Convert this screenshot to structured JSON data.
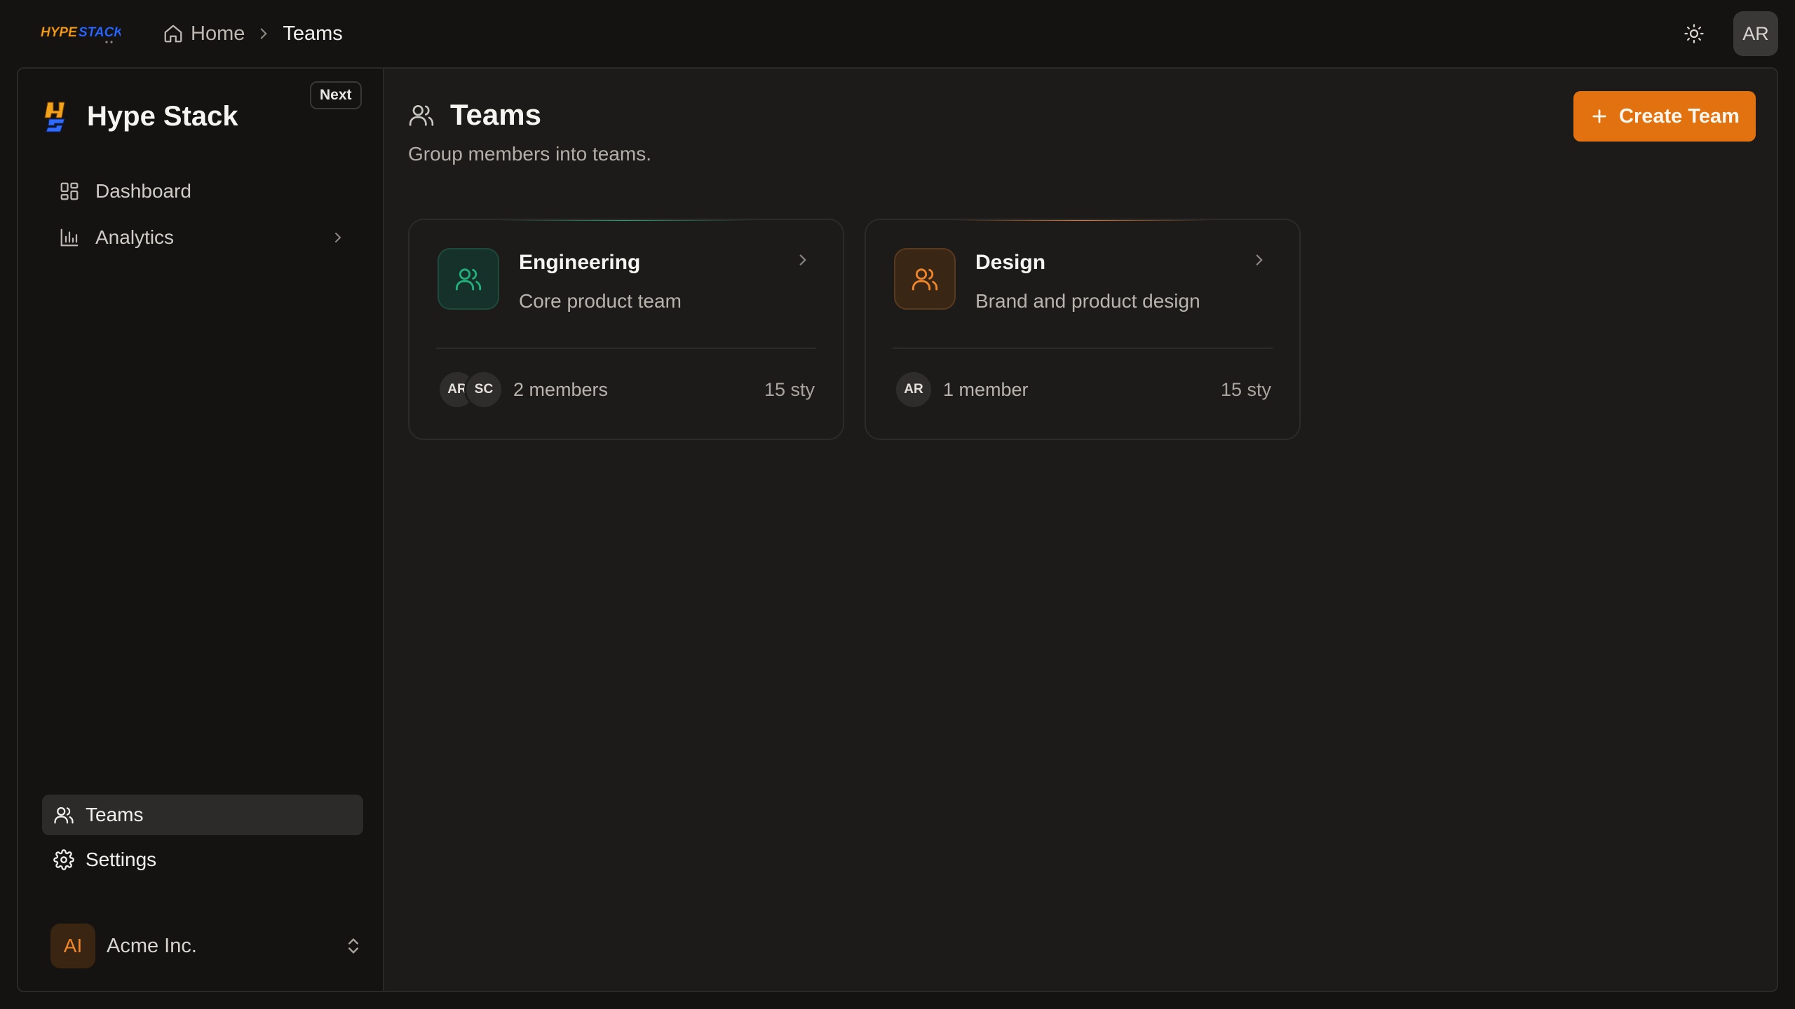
{
  "topbar": {
    "logo_text": "HYPE STACK",
    "breadcrumb": {
      "home": "Home",
      "current": "Teams"
    },
    "user_initials": "AR"
  },
  "sidebar": {
    "brand_name": "Hype Stack",
    "badge": "Next",
    "nav": [
      {
        "label": "Dashboard",
        "icon": "dashboard-icon"
      },
      {
        "label": "Analytics",
        "icon": "bar-chart-icon"
      }
    ],
    "bottom_nav": [
      {
        "label": "Teams",
        "icon": "users-icon",
        "active": true
      },
      {
        "label": "Settings",
        "icon": "gear-icon"
      }
    ],
    "org": {
      "initials": "AI",
      "name": "Acme Inc."
    }
  },
  "main": {
    "title": "Teams",
    "subtitle": "Group members into teams.",
    "create_label": "Create Team",
    "teams": [
      {
        "name": "Engineering",
        "description": "Core product team",
        "members": [
          "AR",
          "SC"
        ],
        "member_label": "2 members",
        "meta": "15 sty",
        "accent": "#22b07d"
      },
      {
        "name": "Design",
        "description": "Brand and product design",
        "members": [
          "AR"
        ],
        "member_label": "1 member",
        "meta": "15 sty",
        "accent": "#f0862a"
      }
    ]
  },
  "colors": {
    "accent": "#e2710f",
    "background": "#151311",
    "surface": "#1c1b1a",
    "sidebar": "#141312"
  }
}
